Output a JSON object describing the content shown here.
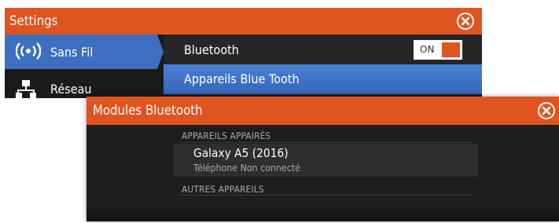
{
  "settings": {
    "title": "Settings",
    "sidebar": [
      {
        "label": "Sans Fil",
        "icon": "wireless-icon",
        "active": true
      },
      {
        "label": "Réseau",
        "icon": "network-icon",
        "active": false
      }
    ],
    "bluetooth_label": "Bluetooth",
    "toggle_label": "ON",
    "devices_row_label": "Appareils Blue Tooth"
  },
  "modal": {
    "title": "Modules Bluetooth",
    "paired_header": "APPAREILS APPAIRÉS",
    "device_name": "Galaxy A5 (2016)",
    "device_status": "Téléphone Non connecté",
    "other_header": "AUTRES APPAREILS"
  },
  "colors": {
    "accent": "#e0541f",
    "selection": "#3d70c0",
    "panel": "#1c1c1c"
  }
}
